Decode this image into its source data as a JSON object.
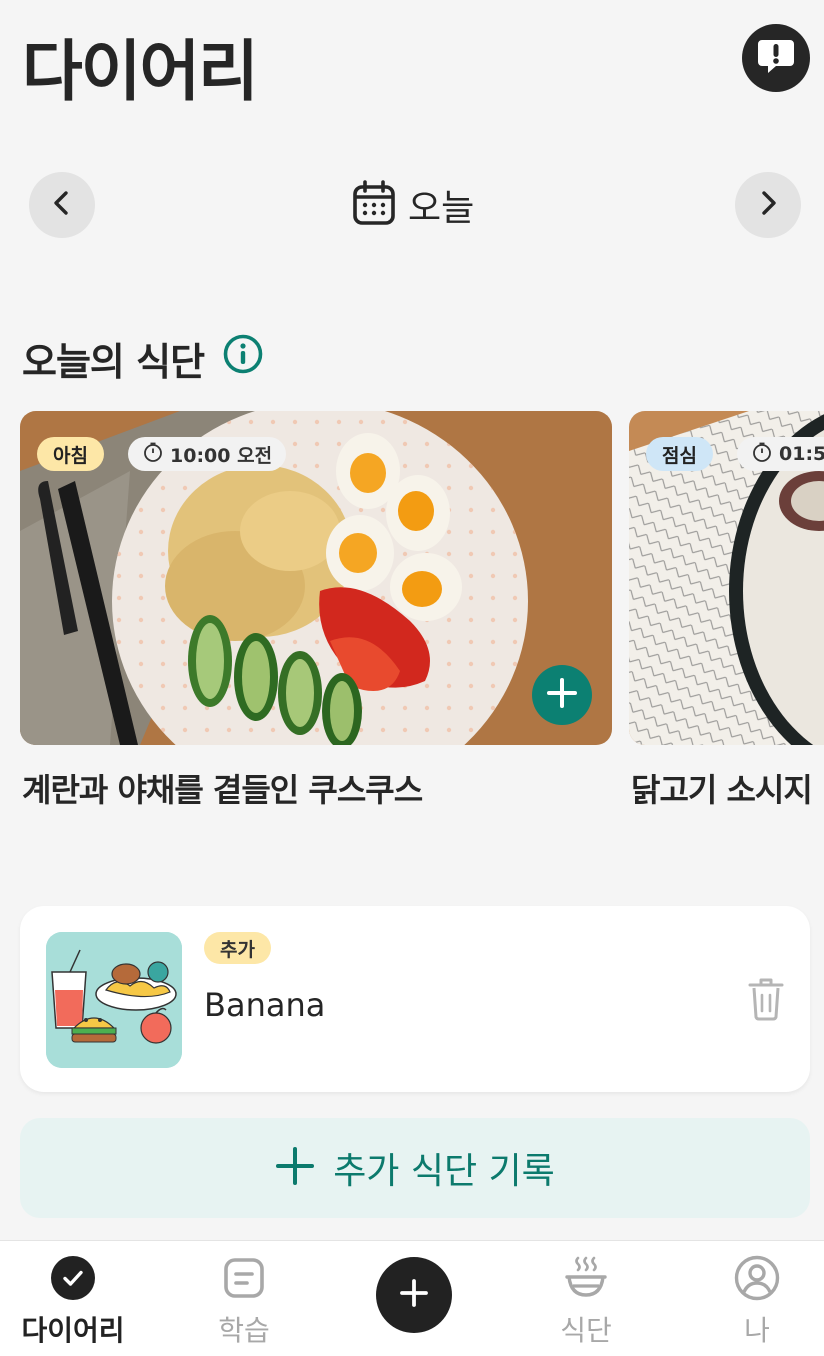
{
  "header": {
    "title": "다이어리",
    "alert_icon": "exclamation-bubble-icon"
  },
  "date_nav": {
    "label": "오늘",
    "prev_icon": "chevron-left-icon",
    "next_icon": "chevron-right-icon",
    "calendar_icon": "calendar-icon"
  },
  "section": {
    "title": "오늘의 식단",
    "info_icon": "info-icon"
  },
  "meals": [
    {
      "type": "아침",
      "type_color": "#fde7a7",
      "time": "10:00 오전",
      "name": "계란과 야채를 곁들인 쿠스쿠스"
    },
    {
      "type": "점심",
      "type_color": "#cfe6f7",
      "time": "01:5",
      "name": "닭고기 소시지"
    }
  ],
  "extra": {
    "badge": "추가",
    "name": "Banana",
    "trash_icon": "trash-icon"
  },
  "add_record": {
    "label": "추가 식단 기록"
  },
  "bottom_nav": {
    "items": [
      {
        "label": "다이어리",
        "icon": "check-circle-icon",
        "active": true
      },
      {
        "label": "학습",
        "icon": "note-icon",
        "active": false
      },
      {
        "label": "",
        "icon": "plus-icon",
        "active": false
      },
      {
        "label": "식단",
        "icon": "bowl-icon",
        "active": false
      },
      {
        "label": "나",
        "icon": "user-circle-icon",
        "active": false
      }
    ]
  },
  "colors": {
    "accent": "#0c8072",
    "dark": "#262626",
    "background": "#f5f5f5"
  }
}
